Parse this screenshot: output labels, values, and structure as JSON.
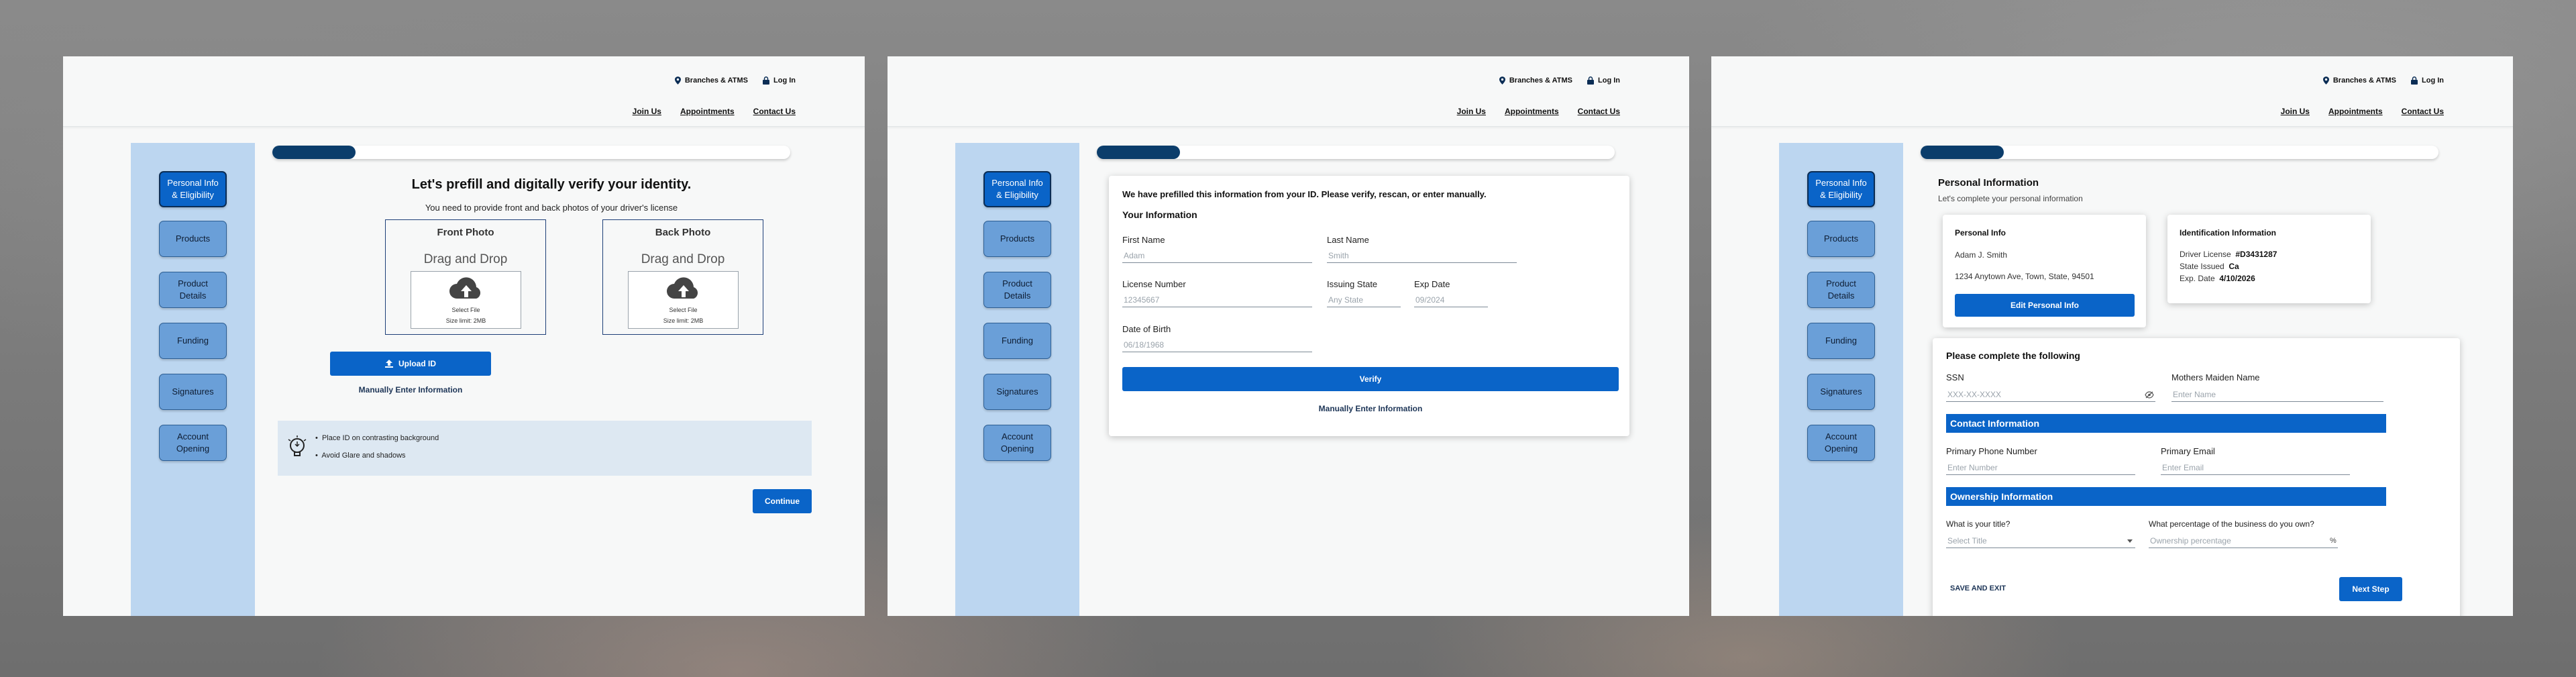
{
  "header": {
    "branches": "Branches & ATMS",
    "login": "Log In",
    "nav": [
      "Join Us",
      "Appointments",
      "Contact Us"
    ]
  },
  "sidebar": {
    "items": [
      "Personal Info\n& Eligibility",
      "Products",
      "Product\nDetails",
      "Funding",
      "Signatures",
      "Account\nOpening"
    ]
  },
  "screen1": {
    "progress": 0.16,
    "title": "Let's prefill and digitally verify your identity.",
    "subtitle": "You need to provide front and back photos of your driver's license",
    "front": {
      "title": "Front Photo",
      "sub": "Drag and Drop",
      "select": "Select File",
      "limit": "Size limit: 2MB"
    },
    "back": {
      "title": "Back Photo",
      "sub": "Drag and Drop",
      "select": "Select File",
      "limit": "Size limit: 2MB"
    },
    "upload": "Upload ID",
    "manual": "Manually Enter Information",
    "tips": [
      "Place ID on contrasting background",
      "Avoid Glare and shadows"
    ],
    "continue": "Continue"
  },
  "screen2": {
    "progress": 0.16,
    "heading": "We have prefilled this information from your ID.  Please verify, rescan, or enter manually.",
    "section": "Your Information",
    "fields": {
      "first_name": {
        "label": "First Name",
        "value": "Adam"
      },
      "last_name": {
        "label": "Last Name",
        "value": "Smith"
      },
      "license": {
        "label": "License Number",
        "value": "12345667"
      },
      "issuing_state": {
        "label": "Issuing State",
        "value": "Any State"
      },
      "exp_date": {
        "label": "Exp Date",
        "value": "09/2024"
      },
      "dob": {
        "label": "Date of Birth",
        "value": "06/18/1968"
      }
    },
    "verify": "Verify",
    "manual": "Manually Enter Information"
  },
  "screen3": {
    "progress": 0.16,
    "title": "Personal Information",
    "subtitle": "Let's complete your personal information",
    "personal_info": {
      "heading": "Personal Info",
      "name": "Adam J. Smith",
      "address": "1234 Anytown Ave, Town, State, 94501",
      "button": "Edit Personal Info"
    },
    "id_info": {
      "heading": "Identification Information",
      "license_label": "Driver License",
      "license_value": "#D3431287",
      "state_label": "State Issued",
      "state_value": "Ca",
      "exp_label": "Exp. Date",
      "exp_value": "4/10/2026"
    },
    "form_heading": "Please complete the following",
    "ssn": {
      "label": "SSN",
      "placeholder": "XXX-XX-XXXX"
    },
    "maiden": {
      "label": "Mothers Maiden Name",
      "placeholder": "Enter Name"
    },
    "contact_section": "Contact Information",
    "phone": {
      "label": "Primary Phone Number",
      "placeholder": "Enter Number"
    },
    "email": {
      "label": "Primary Email",
      "placeholder": "Enter Email"
    },
    "ownership_section": "Ownership Information",
    "title_field": {
      "label": "What is your title?",
      "placeholder": "Select Title"
    },
    "percent": {
      "label": "What percentage of the business do you own?",
      "placeholder": "Ownership percentage",
      "suffix": "%"
    },
    "save_exit": "SAVE AND EXIT",
    "next": "Next Step"
  },
  "colors": {
    "primary": "#0a64c8",
    "progress": "#0b3d6b",
    "sidebar": "#bcd6f0",
    "section_bar": "#0a64c8"
  }
}
